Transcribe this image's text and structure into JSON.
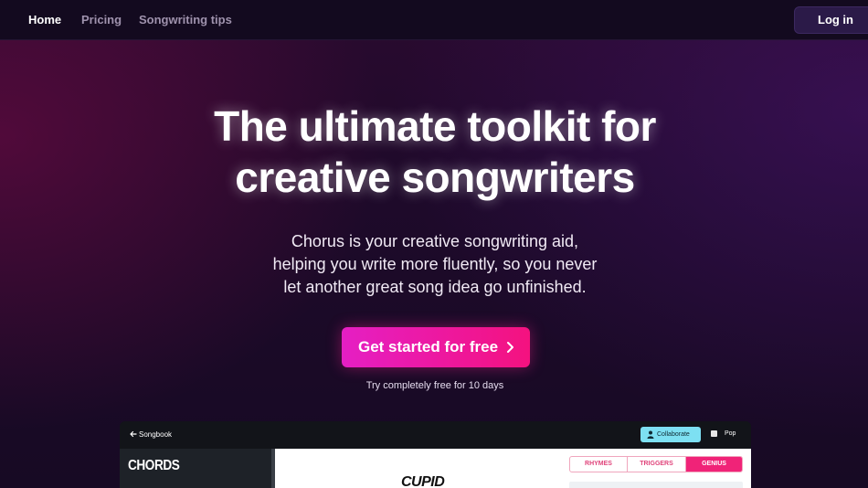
{
  "nav": {
    "links": [
      {
        "label": "Home",
        "active": true
      },
      {
        "label": "Pricing",
        "active": false
      },
      {
        "label": "Songwriting tips",
        "active": false
      }
    ],
    "login_label": "Log in"
  },
  "hero": {
    "title_line1": "The ultimate toolkit for",
    "title_line2": "creative songwriters",
    "subtitle_line1": "Chorus is your creative songwriting aid,",
    "subtitle_line2": "helping you write more fluently, so you never",
    "subtitle_line3": "let another great song idea go unfinished.",
    "cta_label": "Get started for free",
    "cta_icon": "chevron-right-icon",
    "trial_note": "Try completely free for 10 days"
  },
  "preview": {
    "back_icon": "arrow-left-icon",
    "breadcrumb": "Songbook",
    "collaborate_label": "Collaborate",
    "collaborate_icon": "user-icon",
    "genre_icon": "folder-icon",
    "genre_label": "Pop",
    "sidebar_heading": "CHORDS",
    "song_title": "CUPID",
    "tabs": [
      "RHYMES",
      "TRIGGERS",
      "GENIUS"
    ],
    "active_tab": "GENIUS"
  },
  "colors": {
    "accent_pink": "#f02378",
    "cta_gradient_start": "#e51fc4",
    "cta_gradient_end": "#f4127f",
    "collaborate_cyan": "#7de0f2",
    "nav_background": "#130a1f"
  }
}
